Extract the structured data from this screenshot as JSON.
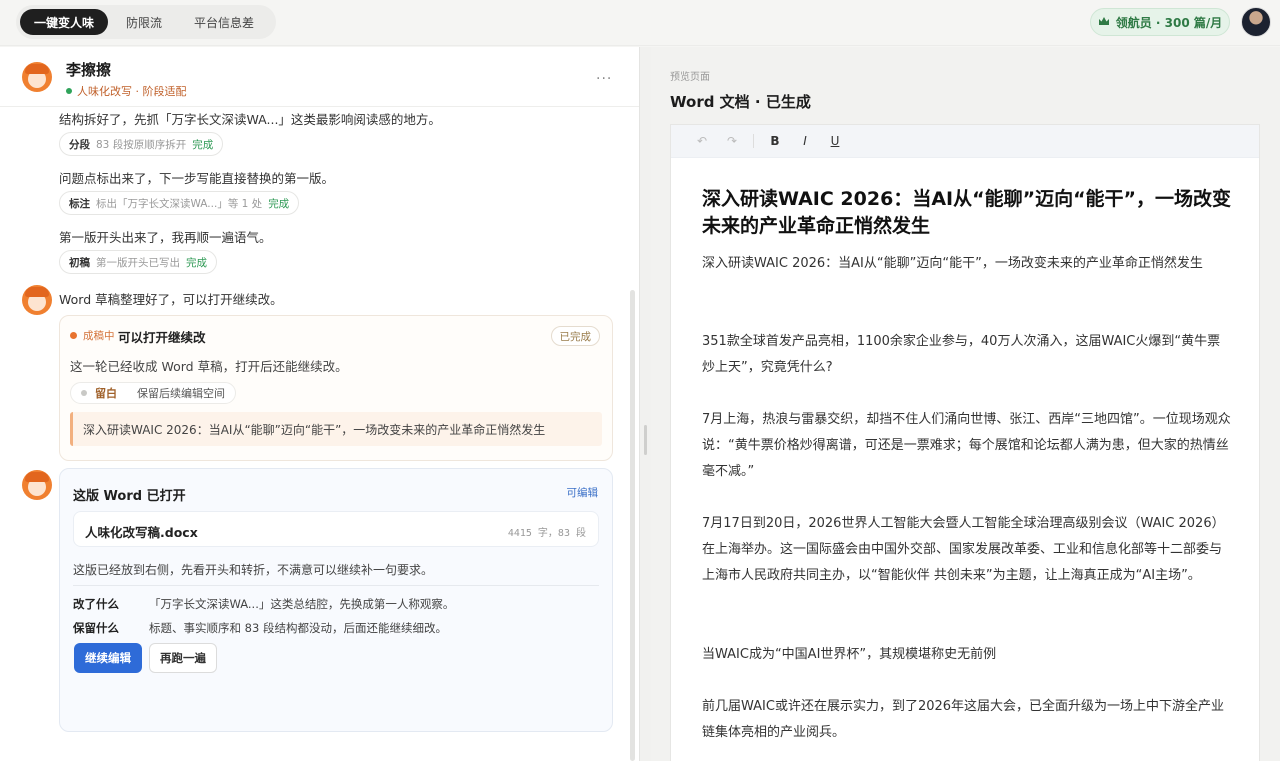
{
  "topbar": {
    "tabs": [
      {
        "label": "一键变人味",
        "active": true
      },
      {
        "label": "防限流",
        "active": false
      },
      {
        "label": "平台信息差",
        "active": false
      }
    ],
    "plan_icon": "crown-icon",
    "plan_label": "领航员 · 300 篇/月"
  },
  "chat": {
    "name": "李擦擦",
    "status": "人味化改写 · 阶段适配",
    "more": "···",
    "messages": [
      {
        "text": "结构拆好了，先抓「万字长文深读WA...」这类最影响阅读感的地方。",
        "chip": {
          "label": "分段",
          "desc": "83 段按原顺序拆开",
          "status": "完成"
        }
      },
      {
        "text": "问题点标出来了，下一步写能直接替换的第一版。",
        "chip": {
          "label": "标注",
          "desc": "标出「万字长文深读WA...」等 1 处",
          "status": "完成"
        }
      },
      {
        "text": "第一版开头出来了，我再顺一遍语气。",
        "chip": {
          "label": "初稿",
          "desc": "第一版开头已写出",
          "status": "完成"
        }
      }
    ],
    "word_ready_text": "Word 草稿整理好了，可以打开继续改。",
    "progress_card": {
      "badge": "成稿中",
      "title": "可以打开继续改",
      "done_tag": "已完成",
      "desc": "这一轮已经收成 Word 草稿，打开后还能继续改。",
      "keep_key": "留白",
      "keep_value": "保留后续编辑空间",
      "quote": "深入研读WAIC 2026：当AI从“能聊”迈向“能干”，一场改变未来的产业革命正悄然发生"
    },
    "doc_card": {
      "title": "这版 Word 已打开",
      "edit_label": "可编辑",
      "file_name": "人味化改写稿.docx",
      "file_meta": "4415 字，83 段",
      "desc": "这版已经放到右侧，先看开头和转折，不满意可以继续补一句要求。",
      "rows": [
        {
          "k": "改了什么",
          "v": "「万字长文深读WA...」这类总结腔，先换成第一人称观察。"
        },
        {
          "k": "保留什么",
          "v": "标题、事实顺序和 83 段结构都没动，后面还能继续细改。"
        }
      ],
      "primary_button": "继续编辑",
      "secondary_button": "再跑一遍"
    }
  },
  "preview": {
    "label": "预览页面",
    "title": "Word 文档 · 已生成",
    "toolbar": {
      "undo": "↶",
      "redo": "↷",
      "bold": "B",
      "italic": "I",
      "underline": "U"
    },
    "heading": "深入研读WAIC 2026：当AI从“能聊”迈向“能干”，一场改变未来的产业革命正悄然发生",
    "paragraphs": [
      "深入研读WAIC 2026：当AI从“能聊”迈向“能干”，一场改变未来的产业革命正悄然发生",
      "351款全球首发产品亮相，1100余家企业参与，40万人次涌入，这届WAIC火爆到“黄牛票炒上天”，究竟凭什么?",
      "7月上海，热浪与雷暴交织，却挡不住人们涌向世博、张江、西岸“三地四馆”。一位现场观众说：“黄牛票价格炒得离谱，可还是一票难求；每个展馆和论坛都人满为患，但大家的热情丝毫不减。”",
      "7月17日到20日，2026世界人工智能大会暨人工智能全球治理高级别会议（WAIC 2026）在上海举办。这一国际盛会由中国外交部、国家发展改革委、工业和信息化部等十二部委与上海市人民政府共同主办，以“智能伙伴 共创未来”为主题，让上海真正成为“AI主场”。",
      "当WAIC成为“中国AI世界杯”，其规模堪称史无前例",
      "前几届WAIC或许还在展示实力，到了2026年这届大会，已全面升级为一场上中下游全产业链集体亮相的产业阅兵。"
    ]
  },
  "colors": {
    "accent": "#2e6bd8",
    "ok": "#2f9a55",
    "warm": "#e8732f"
  }
}
